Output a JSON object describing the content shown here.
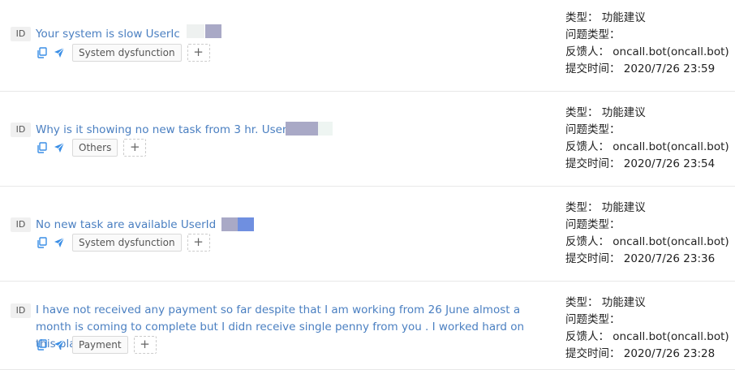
{
  "tickets": [
    {
      "id_label": "ID",
      "title": "Your system is slow UserIc",
      "tag": "System dysfunction",
      "add_label": "+",
      "meta": {
        "type": "类型：  功能建议",
        "issue_type": "问题类型：",
        "reporter": "反馈人：  oncall.bot(oncall.bot)",
        "submit_time": "提交时间：  2020/7/26 23:59"
      }
    },
    {
      "id_label": "ID",
      "title": "Why is it showing no new task from 3 hr. UserId",
      "tag": "Others",
      "add_label": "+",
      "meta": {
        "type": "类型：  功能建议",
        "issue_type": "问题类型：",
        "reporter": "反馈人：  oncall.bot(oncall.bot)",
        "submit_time": "提交时间：  2020/7/26 23:54"
      }
    },
    {
      "id_label": "ID",
      "title": "No new task are available UserId",
      "tag": "System dysfunction",
      "add_label": "+",
      "meta": {
        "type": "类型：  功能建议",
        "issue_type": "问题类型：",
        "reporter": "反馈人：  oncall.bot(oncall.bot)",
        "submit_time": "提交时间：  2020/7/26 23:36"
      }
    },
    {
      "id_label": "ID",
      "title": "I have not received any payment so far despite that I am working from 26 June almost a month is coming to complete but I didn receive single penny from you . I worked hard on this plat...",
      "tag": "Payment",
      "add_label": "+",
      "meta": {
        "type": "类型：  功能建议",
        "issue_type": "问题类型：",
        "reporter": "反馈人：  oncall.bot(oncall.bot)",
        "submit_time": "提交时间：  2020/7/26 23:28"
      }
    }
  ],
  "icons": {
    "copy": "copy-icon",
    "share": "send-icon"
  },
  "colors": {
    "link": "#4a7fc1",
    "icon": "#3a8ee6",
    "redact": "#9aa3cf"
  }
}
